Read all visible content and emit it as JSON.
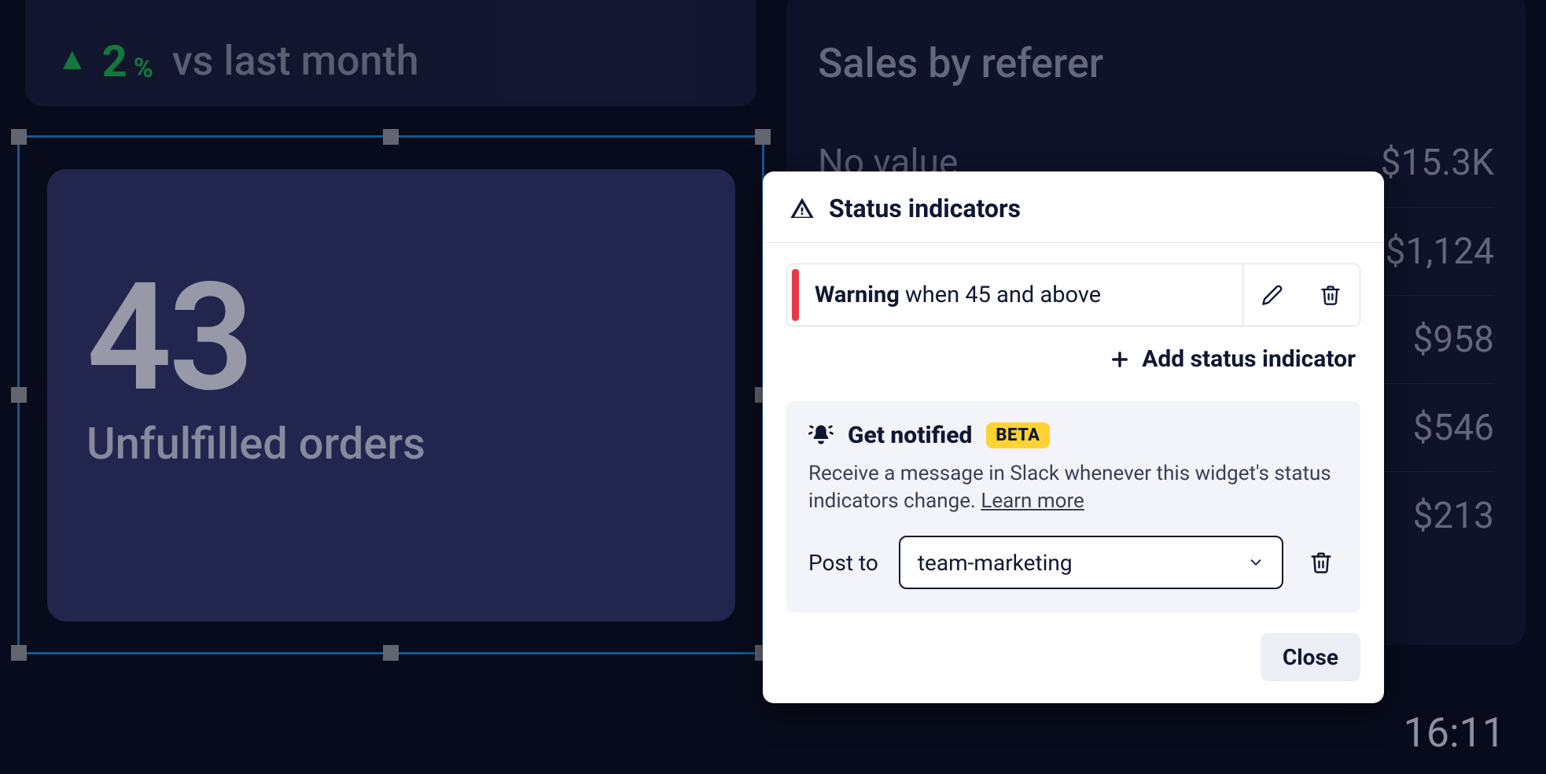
{
  "change": {
    "value": "2",
    "pct_suffix": "%",
    "label": "vs last month"
  },
  "orders": {
    "value": "43",
    "label": "Unfulfilled orders"
  },
  "sales": {
    "title": "Sales by referer",
    "rows": [
      {
        "label": "No value",
        "value": "$15.3K"
      },
      {
        "label": "",
        "value": "$1,124"
      },
      {
        "label": "",
        "value": "$958"
      },
      {
        "label": "",
        "value": "$546"
      },
      {
        "label": "",
        "value": "$213"
      }
    ]
  },
  "popup": {
    "title": "Status indicators",
    "rule": {
      "condition_label": "Warning",
      "condition_rest": " when 45 and above"
    },
    "add_label": "Add status indicator",
    "notify": {
      "title": "Get notified",
      "badge": "BETA",
      "desc_1": "Receive a message in Slack whenever this widget's status indicators change. ",
      "learn_more": "Learn more",
      "post_to_label": "Post to",
      "channel": "team-marketing"
    },
    "close_label": "Close"
  },
  "clock": "16:11"
}
